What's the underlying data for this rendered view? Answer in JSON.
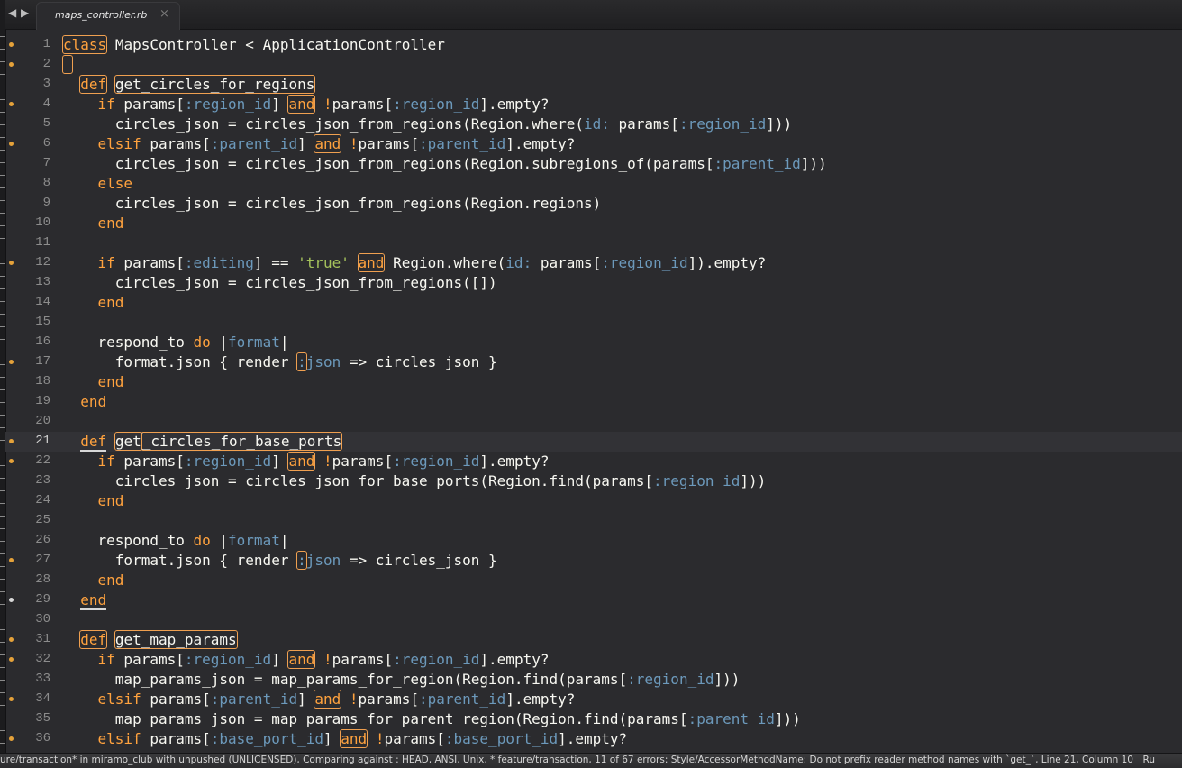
{
  "tab": {
    "title": "maps_controller.rb",
    "close": "×"
  },
  "nav": {
    "back": "◀",
    "forward": "▶"
  },
  "status": {
    "left": "ure/transaction* in miramo_club with unpushed (UNLICENSED), Comparing against : HEAD, ANSI, Unix, * feature/transaction, 11 of 67 errors: Style/AccessorMethodName: Do not prefix reader method names with `get_`, Line 21, Column 10",
    "right": "Ru"
  },
  "colors": {
    "keyword": "#ffa23e",
    "symbol": "#6c99bb",
    "string": "#a5c25c",
    "modified_dot": "#e5a23a"
  },
  "current_line": 21,
  "lines": [
    {
      "n": "1",
      "mark": "dot",
      "tokens": [
        [
          "class",
          "kw box"
        ],
        [
          " ",
          ""
        ],
        [
          "MapsController < ApplicationController",
          ""
        ]
      ]
    },
    {
      "n": "2",
      "mark": "dot",
      "tokens": [
        [
          " ",
          "box"
        ]
      ]
    },
    {
      "n": "3",
      "mark": "",
      "tokens": [
        [
          "  ",
          ""
        ],
        [
          "def",
          "kw box"
        ],
        [
          " ",
          ""
        ],
        [
          "get_circles_for_regions",
          "box"
        ]
      ]
    },
    {
      "n": "4",
      "mark": "dot",
      "tokens": [
        [
          "    ",
          ""
        ],
        [
          "if",
          "kw"
        ],
        [
          " params[",
          ""
        ],
        [
          ":region_id",
          "sym"
        ],
        [
          "] ",
          ""
        ],
        [
          "and",
          "kw box"
        ],
        [
          " ",
          ""
        ],
        [
          "!",
          "kw"
        ],
        [
          "params[",
          ""
        ],
        [
          ":region_id",
          "sym"
        ],
        [
          "].empty?",
          ""
        ]
      ]
    },
    {
      "n": "5",
      "mark": "",
      "tokens": [
        [
          "      circles_json = circles_json_from_regions(Region.where(",
          ""
        ],
        [
          "id:",
          "sym"
        ],
        [
          " params[",
          ""
        ],
        [
          ":region_id",
          "sym"
        ],
        [
          "]))",
          ""
        ]
      ]
    },
    {
      "n": "6",
      "mark": "dot",
      "tokens": [
        [
          "    ",
          ""
        ],
        [
          "elsif",
          "kw"
        ],
        [
          " params[",
          ""
        ],
        [
          ":parent_id",
          "sym"
        ],
        [
          "] ",
          ""
        ],
        [
          "and",
          "kw box"
        ],
        [
          " ",
          ""
        ],
        [
          "!",
          "kw"
        ],
        [
          "params[",
          ""
        ],
        [
          ":parent_id",
          "sym"
        ],
        [
          "].empty?",
          ""
        ]
      ]
    },
    {
      "n": "7",
      "mark": "",
      "tokens": [
        [
          "      circles_json = circles_json_from_regions(Region.subregions_of(params[",
          ""
        ],
        [
          ":parent_id",
          "sym"
        ],
        [
          "]))",
          ""
        ]
      ]
    },
    {
      "n": "8",
      "mark": "",
      "tokens": [
        [
          "    ",
          ""
        ],
        [
          "else",
          "kw"
        ]
      ]
    },
    {
      "n": "9",
      "mark": "",
      "tokens": [
        [
          "      circles_json = circles_json_from_regions(Region.regions)",
          ""
        ]
      ]
    },
    {
      "n": "10",
      "mark": "",
      "tokens": [
        [
          "    ",
          ""
        ],
        [
          "end",
          "kw"
        ]
      ]
    },
    {
      "n": "11",
      "mark": "",
      "tokens": []
    },
    {
      "n": "12",
      "mark": "dot",
      "tokens": [
        [
          "    ",
          ""
        ],
        [
          "if",
          "kw"
        ],
        [
          " params[",
          ""
        ],
        [
          ":editing",
          "sym"
        ],
        [
          "] == ",
          ""
        ],
        [
          "'true'",
          "str"
        ],
        [
          " ",
          ""
        ],
        [
          "and",
          "kw box"
        ],
        [
          " Region.where(",
          ""
        ],
        [
          "id:",
          "sym"
        ],
        [
          " params[",
          ""
        ],
        [
          ":region_id",
          "sym"
        ],
        [
          "]).empty?",
          ""
        ]
      ]
    },
    {
      "n": "13",
      "mark": "",
      "tokens": [
        [
          "      circles_json = circles_json_from_regions([])",
          ""
        ]
      ]
    },
    {
      "n": "14",
      "mark": "",
      "tokens": [
        [
          "    ",
          ""
        ],
        [
          "end",
          "kw"
        ]
      ]
    },
    {
      "n": "15",
      "mark": "",
      "tokens": []
    },
    {
      "n": "16",
      "mark": "",
      "tokens": [
        [
          "    respond_to ",
          ""
        ],
        [
          "do",
          "kw"
        ],
        [
          " |",
          ""
        ],
        [
          "format",
          "sym"
        ],
        [
          "|",
          ""
        ]
      ]
    },
    {
      "n": "17",
      "mark": "dot",
      "tokens": [
        [
          "      format.json { render ",
          ""
        ],
        [
          ":",
          "sym box"
        ],
        [
          "json",
          "sym"
        ],
        [
          " => circles_json }",
          ""
        ]
      ]
    },
    {
      "n": "18",
      "mark": "",
      "tokens": [
        [
          "    ",
          ""
        ],
        [
          "end",
          "kw"
        ]
      ]
    },
    {
      "n": "19",
      "mark": "",
      "tokens": [
        [
          "  ",
          ""
        ],
        [
          "end",
          "kw"
        ]
      ]
    },
    {
      "n": "20",
      "mark": "",
      "tokens": []
    },
    {
      "n": "21",
      "mark": "dot",
      "tokens": [
        [
          "  ",
          ""
        ],
        [
          "def",
          "kw ul"
        ],
        [
          " ",
          ""
        ],
        [
          "get",
          "box"
        ],
        [
          "_circles_for_base_ports",
          "box cursor"
        ]
      ]
    },
    {
      "n": "22",
      "mark": "dot",
      "tokens": [
        [
          "    ",
          ""
        ],
        [
          "if",
          "kw"
        ],
        [
          " params[",
          ""
        ],
        [
          ":region_id",
          "sym"
        ],
        [
          "] ",
          ""
        ],
        [
          "and",
          "kw box"
        ],
        [
          " ",
          ""
        ],
        [
          "!",
          "kw"
        ],
        [
          "params[",
          ""
        ],
        [
          ":region_id",
          "sym"
        ],
        [
          "].empty?",
          ""
        ]
      ]
    },
    {
      "n": "23",
      "mark": "",
      "tokens": [
        [
          "      circles_json = circles_json_for_base_ports(Region.find(params[",
          ""
        ],
        [
          ":region_id",
          "sym"
        ],
        [
          "]))",
          ""
        ]
      ]
    },
    {
      "n": "24",
      "mark": "",
      "tokens": [
        [
          "    ",
          ""
        ],
        [
          "end",
          "kw"
        ]
      ]
    },
    {
      "n": "25",
      "mark": "",
      "tokens": []
    },
    {
      "n": "26",
      "mark": "",
      "tokens": [
        [
          "    respond_to ",
          ""
        ],
        [
          "do",
          "kw"
        ],
        [
          " |",
          ""
        ],
        [
          "format",
          "sym"
        ],
        [
          "|",
          ""
        ]
      ]
    },
    {
      "n": "27",
      "mark": "dot",
      "tokens": [
        [
          "      format.json { render ",
          ""
        ],
        [
          ":",
          "sym box"
        ],
        [
          "json",
          "sym"
        ],
        [
          " => circles_json }",
          ""
        ]
      ]
    },
    {
      "n": "28",
      "mark": "",
      "tokens": [
        [
          "    ",
          ""
        ],
        [
          "end",
          "kw"
        ]
      ]
    },
    {
      "n": "29",
      "mark": "dot-white",
      "tokens": [
        [
          "  ",
          ""
        ],
        [
          "end",
          "kw ul"
        ]
      ]
    },
    {
      "n": "30",
      "mark": "",
      "tokens": []
    },
    {
      "n": "31",
      "mark": "dot",
      "tokens": [
        [
          "  ",
          ""
        ],
        [
          "def",
          "kw box"
        ],
        [
          " ",
          ""
        ],
        [
          "get_map_params",
          "box"
        ]
      ]
    },
    {
      "n": "32",
      "mark": "dot",
      "tokens": [
        [
          "    ",
          ""
        ],
        [
          "if",
          "kw"
        ],
        [
          " params[",
          ""
        ],
        [
          ":region_id",
          "sym"
        ],
        [
          "] ",
          ""
        ],
        [
          "and",
          "kw box"
        ],
        [
          " ",
          ""
        ],
        [
          "!",
          "kw"
        ],
        [
          "params[",
          ""
        ],
        [
          ":region_id",
          "sym"
        ],
        [
          "].empty?",
          ""
        ]
      ]
    },
    {
      "n": "33",
      "mark": "",
      "tokens": [
        [
          "      map_params_json = map_params_for_region(Region.find(params[",
          ""
        ],
        [
          ":region_id",
          "sym"
        ],
        [
          "]))",
          ""
        ]
      ]
    },
    {
      "n": "34",
      "mark": "dot",
      "tokens": [
        [
          "    ",
          ""
        ],
        [
          "elsif",
          "kw"
        ],
        [
          " params[",
          ""
        ],
        [
          ":parent_id",
          "sym"
        ],
        [
          "] ",
          ""
        ],
        [
          "and",
          "kw box"
        ],
        [
          " ",
          ""
        ],
        [
          "!",
          "kw"
        ],
        [
          "params[",
          ""
        ],
        [
          ":parent_id",
          "sym"
        ],
        [
          "].empty?",
          ""
        ]
      ]
    },
    {
      "n": "35",
      "mark": "",
      "tokens": [
        [
          "      map_params_json = map_params_for_parent_region(Region.find(params[",
          ""
        ],
        [
          ":parent_id",
          "sym"
        ],
        [
          "]))",
          ""
        ]
      ]
    },
    {
      "n": "36",
      "mark": "dot",
      "tokens": [
        [
          "    ",
          ""
        ],
        [
          "elsif",
          "kw"
        ],
        [
          " params[",
          ""
        ],
        [
          ":base_port_id",
          "sym"
        ],
        [
          "] ",
          ""
        ],
        [
          "and",
          "kw box"
        ],
        [
          " ",
          ""
        ],
        [
          "!",
          "kw"
        ],
        [
          "params[",
          ""
        ],
        [
          ":base_port_id",
          "sym"
        ],
        [
          "].empty?",
          ""
        ]
      ]
    }
  ]
}
